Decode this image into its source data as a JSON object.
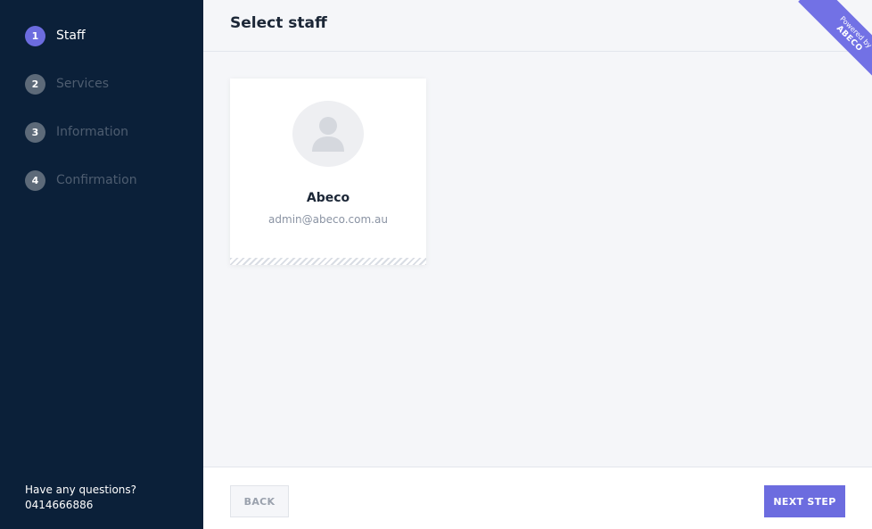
{
  "steps": [
    {
      "num": "1",
      "label": "Staff",
      "active": true
    },
    {
      "num": "2",
      "label": "Services",
      "active": false
    },
    {
      "num": "3",
      "label": "Information",
      "active": false
    },
    {
      "num": "4",
      "label": "Confirmation",
      "active": false
    }
  ],
  "help": {
    "text": "Have any questions?",
    "phone": "0414666886"
  },
  "header": {
    "title": "Select staff"
  },
  "ribbon": {
    "powered": "Powered by",
    "brand": "ABECO"
  },
  "staff": [
    {
      "name": "Abeco",
      "email": "admin@abeco.com.au",
      "icon": "user-avatar-icon"
    }
  ],
  "footer": {
    "back_label": "BACK",
    "next_label": "NEXT STEP"
  },
  "colors": {
    "sidebar": "#0b2039",
    "accent": "#6c6cdf",
    "background": "#f5f6f9"
  }
}
